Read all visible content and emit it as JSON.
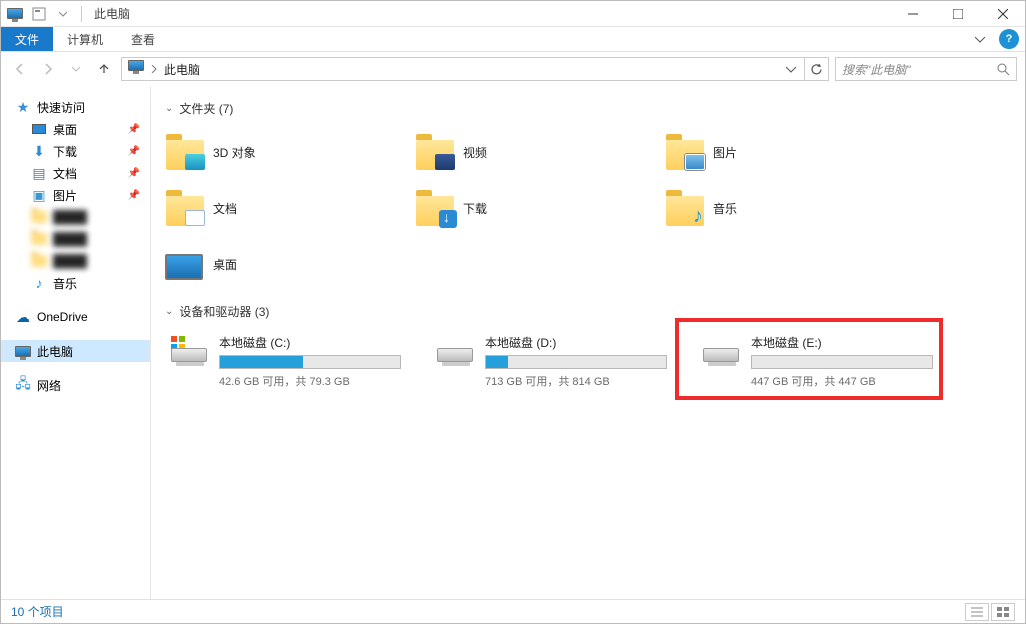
{
  "title": "此电脑",
  "ribbon": {
    "file": "文件",
    "computer": "计算机",
    "view": "查看"
  },
  "address": {
    "crumb": "此电脑"
  },
  "search": {
    "placeholder": "搜索\"此电脑\""
  },
  "sidebar": {
    "quick": "快速访问",
    "desktop": "桌面",
    "downloads": "下载",
    "documents": "文档",
    "pictures": "图片",
    "music": "音乐",
    "onedrive": "OneDrive",
    "thispc": "此电脑",
    "network": "网络"
  },
  "sections": {
    "folders": "文件夹 (7)",
    "drives": "设备和驱动器 (3)"
  },
  "folders": {
    "objects3d": "3D 对象",
    "videos": "视频",
    "pictures": "图片",
    "documents": "文档",
    "downloads": "下载",
    "music": "音乐",
    "desktop": "桌面"
  },
  "drives": [
    {
      "name": "本地磁盘 (C:)",
      "stat": "42.6 GB 可用，共 79.3 GB",
      "fill": 46,
      "win": true
    },
    {
      "name": "本地磁盘 (D:)",
      "stat": "713 GB 可用，共 814 GB",
      "fill": 12,
      "win": false
    },
    {
      "name": "本地磁盘 (E:)",
      "stat": "447 GB 可用，共 447 GB",
      "fill": 0,
      "win": false
    }
  ],
  "status": {
    "items": "10 个项目"
  }
}
